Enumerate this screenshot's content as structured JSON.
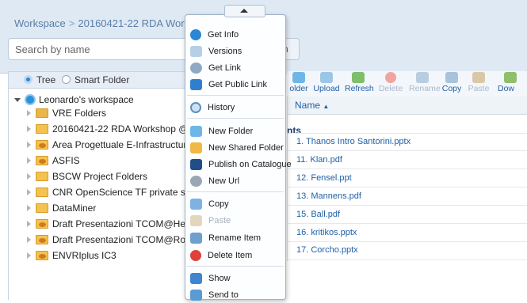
{
  "breadcrumb": {
    "root": "Workspace",
    "separator": ">",
    "current": "20160421-22 RDA Workshop"
  },
  "search": {
    "placeholder": "Search by name",
    "button_label_partial": "h"
  },
  "tree_toggle": {
    "tree_label": "Tree",
    "smart_folder_label": "Smart Folder",
    "selected": "Tree"
  },
  "tree": {
    "root_label": "Leonardo's workspace",
    "items": [
      {
        "label": "VRE Folders",
        "type": "vre"
      },
      {
        "label": "20160421-22 RDA Workshop @ Santorini",
        "type": "folder"
      },
      {
        "label": "Area Progettuale E-Infrastructures",
        "type": "shared"
      },
      {
        "label": "ASFIS",
        "type": "shared"
      },
      {
        "label": "BSCW Project Folders",
        "type": "folder"
      },
      {
        "label": "CNR OpenScience TF private spaces",
        "type": "folder"
      },
      {
        "label": "DataMiner",
        "type": "folder"
      },
      {
        "label": "Draft Presentazioni TCOM@Heraklion@",
        "type": "shared"
      },
      {
        "label": "Draft Presentazioni TCOM@Rome@FA",
        "type": "shared"
      },
      {
        "label": "ENVRIplus IC3",
        "type": "shared"
      }
    ]
  },
  "toolbar": {
    "items": [
      {
        "label": "older",
        "icon": "folder-icon",
        "enabled": true
      },
      {
        "label": "Upload",
        "icon": "upload-icon",
        "enabled": true
      },
      {
        "label": "Refresh",
        "icon": "refresh-icon",
        "enabled": true
      },
      {
        "label": "Delete",
        "icon": "delete-icon",
        "enabled": false
      },
      {
        "label": "Rename",
        "icon": "rename-icon",
        "enabled": false
      },
      {
        "label": "Copy",
        "icon": "copy-icon",
        "enabled": true
      },
      {
        "label": "Paste",
        "icon": "paste-icon",
        "enabled": false
      },
      {
        "label": "Dow",
        "icon": "download-icon",
        "enabled": true
      }
    ]
  },
  "file_list": {
    "column_name": "Name",
    "sort_indicator": "▲",
    "group_partial": "nts",
    "files": [
      "1. Thanos Intro Santorini.pptx",
      "11. Klan.pdf",
      "12. Fensel.ppt",
      "13. Mannens.pdf",
      "15. Ball.pdf",
      "16. kritikos.pptx",
      "17. Corcho.pptx"
    ]
  },
  "context_menu": {
    "items": [
      {
        "label": "Get Info",
        "icon": "info-icon",
        "enabled": true
      },
      {
        "label": "Versions",
        "icon": "versions-icon",
        "enabled": true
      },
      {
        "label": "Get Link",
        "icon": "link-icon",
        "enabled": true
      },
      {
        "label": "Get Public Link",
        "icon": "public-link-icon",
        "enabled": true
      },
      {
        "label": "History",
        "icon": "history-icon",
        "enabled": true
      },
      {
        "label": "New Folder",
        "icon": "new-folder-icon",
        "enabled": true
      },
      {
        "label": "New Shared Folder",
        "icon": "new-shared-folder-icon",
        "enabled": true
      },
      {
        "label": "Publish on Catalogue",
        "icon": "catalogue-icon",
        "enabled": true
      },
      {
        "label": "New Url",
        "icon": "url-icon",
        "enabled": true
      },
      {
        "label": "Copy",
        "icon": "copy-icon",
        "enabled": true
      },
      {
        "label": "Paste",
        "icon": "paste-icon",
        "enabled": false
      },
      {
        "label": "Rename Item",
        "icon": "rename-icon",
        "enabled": true
      },
      {
        "label": "Delete Item",
        "icon": "delete-icon",
        "enabled": true
      },
      {
        "label": "Show",
        "icon": "show-icon",
        "enabled": true
      },
      {
        "label": "Send to",
        "icon": "send-icon",
        "enabled": true
      }
    ]
  },
  "colors": {
    "accent": "#2f86d6",
    "link": "#1f5fa6",
    "header_bg": "#dfe9f4",
    "folder": "#f4c24f",
    "delete": "#e0413a"
  }
}
